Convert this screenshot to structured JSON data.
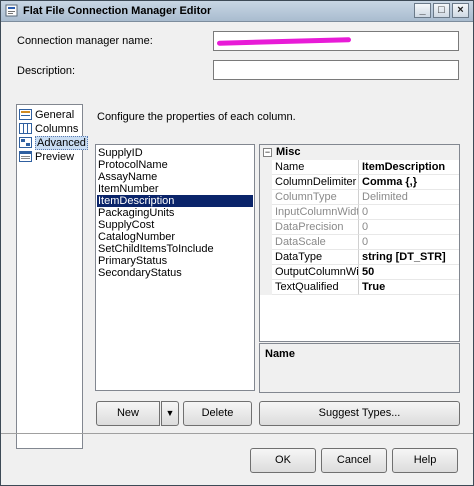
{
  "window": {
    "title": "Flat File Connection Manager Editor",
    "minimize_glyph": "_",
    "maximize_glyph": "□",
    "close_glyph": "×"
  },
  "form": {
    "connection_name_label": "Connection manager name:",
    "connection_name_value": "",
    "description_label": "Description:",
    "description_value": ""
  },
  "nav": {
    "items": [
      {
        "label": "General",
        "icon": "general-page-icon"
      },
      {
        "label": "Columns",
        "icon": "columns-page-icon"
      },
      {
        "label": "Advanced",
        "icon": "advanced-page-icon",
        "selected": true
      },
      {
        "label": "Preview",
        "icon": "preview-page-icon"
      }
    ]
  },
  "main": {
    "instruction": "Configure the properties of each column.",
    "columns": [
      "SupplyID",
      "ProtocolName",
      "AssayName",
      "ItemNumber",
      "ItemDescription",
      "PackagingUnits",
      "SupplyCost",
      "CatalogNumber",
      "SetChildItemsToInclude",
      "PrimaryStatus",
      "SecondaryStatus"
    ],
    "selected_column": "ItemDescription"
  },
  "properties": {
    "category": "Misc",
    "expander_glyph": "−",
    "rows": [
      {
        "name": "Name",
        "value": "ItemDescription",
        "bold": true,
        "disabled": false
      },
      {
        "name": "ColumnDelimiter",
        "value": "Comma {,}",
        "bold": true,
        "disabled": false
      },
      {
        "name": "ColumnType",
        "value": "Delimited",
        "bold": false,
        "disabled": true
      },
      {
        "name": "InputColumnWidth",
        "value": "0",
        "bold": false,
        "disabled": true
      },
      {
        "name": "DataPrecision",
        "value": "0",
        "bold": false,
        "disabled": true
      },
      {
        "name": "DataScale",
        "value": "0",
        "bold": false,
        "disabled": true
      },
      {
        "name": "DataType",
        "value": "string [DT_STR]",
        "bold": true,
        "disabled": false
      },
      {
        "name": "OutputColumnWidth",
        "value": "50",
        "bold": true,
        "disabled": false
      },
      {
        "name": "TextQualified",
        "value": "True",
        "bold": true,
        "disabled": false
      }
    ],
    "description_title": "Name"
  },
  "buttons": {
    "new": "New",
    "new_arrow": "▼",
    "delete": "Delete",
    "suggest_types": "Suggest Types...",
    "ok": "OK",
    "cancel": "Cancel",
    "help": "Help"
  },
  "colors": {
    "selection": "#0a246a",
    "redaction_mark": "#e81bd7"
  }
}
